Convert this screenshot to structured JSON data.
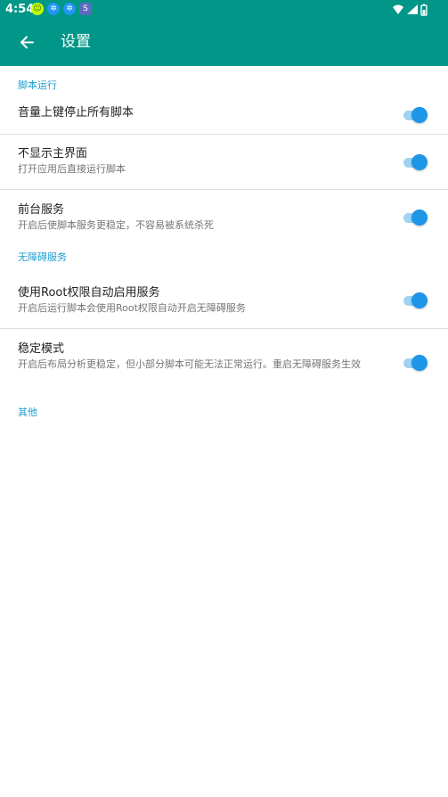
{
  "status_bar": {
    "time": "4:54",
    "notifications": [
      {
        "name": "app-notification-icon",
        "glyph": "☺"
      },
      {
        "name": "bluetooth-icon",
        "glyph": "✲"
      },
      {
        "name": "bluetooth-icon-2",
        "glyph": "✲"
      },
      {
        "name": "app-icon",
        "glyph": "S"
      }
    ],
    "wifi_icon": "wifi-icon",
    "signal_icon": "cellular-signal-icon",
    "battery_icon": "battery-icon"
  },
  "toolbar": {
    "back_icon": "arrow-back-icon",
    "title": "设置",
    "color": "#009688"
  },
  "sections": {
    "script_run": {
      "header": "脚本运行",
      "volume_stop": {
        "title": "音量上键停止所有脚本",
        "enabled": true
      },
      "hide_main": {
        "title": "不显示主界面",
        "summary": "打开应用后直接运行脚本",
        "enabled": true
      },
      "foreground": {
        "title": "前台服务",
        "summary": "开启后使脚本服务更稳定，不容易被系统杀死",
        "enabled": true
      }
    },
    "accessibility": {
      "header": "无障碍服务",
      "root_enable": {
        "title": "使用Root权限自动启用服务",
        "summary": "开启后运行脚本会使用Root权限自动开启无障碍服务",
        "enabled": true
      },
      "stable_mode": {
        "title": "稳定模式",
        "summary": "开启后布局分析更稳定，但小部分脚本可能无法正常运行。重启无障碍服务生效",
        "enabled": true
      }
    },
    "other": {
      "header": "其他"
    }
  },
  "colors": {
    "accent": "#1e9cd0",
    "switch_thumb": "#1e96e8",
    "switch_track": "#9fd3f5"
  }
}
